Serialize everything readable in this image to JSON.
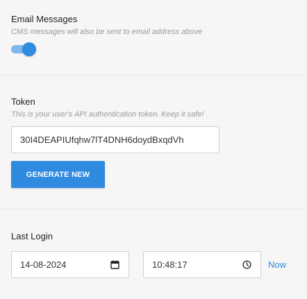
{
  "email_messages": {
    "label": "Email Messages",
    "hint": "CMS messages will also be sent to email address above",
    "enabled": true
  },
  "token": {
    "label": "Token",
    "hint": "This is your user's API authentication token. Keep it safe!",
    "value": "30I4DEAPIUfqhw7lT4DNH6doydBxqdVh",
    "generate_label": "GENERATE NEW"
  },
  "last_login": {
    "label": "Last Login",
    "date": "14-08-2024",
    "time": "10:48:17",
    "now_label": "Now",
    "date_icon": "calendar-icon",
    "time_icon": "clock-icon"
  },
  "colors": {
    "accent": "#2f8ae0",
    "toggle_track": "#7fb7ea",
    "background": "#f6f6f6",
    "hint": "#9a9a9a"
  }
}
